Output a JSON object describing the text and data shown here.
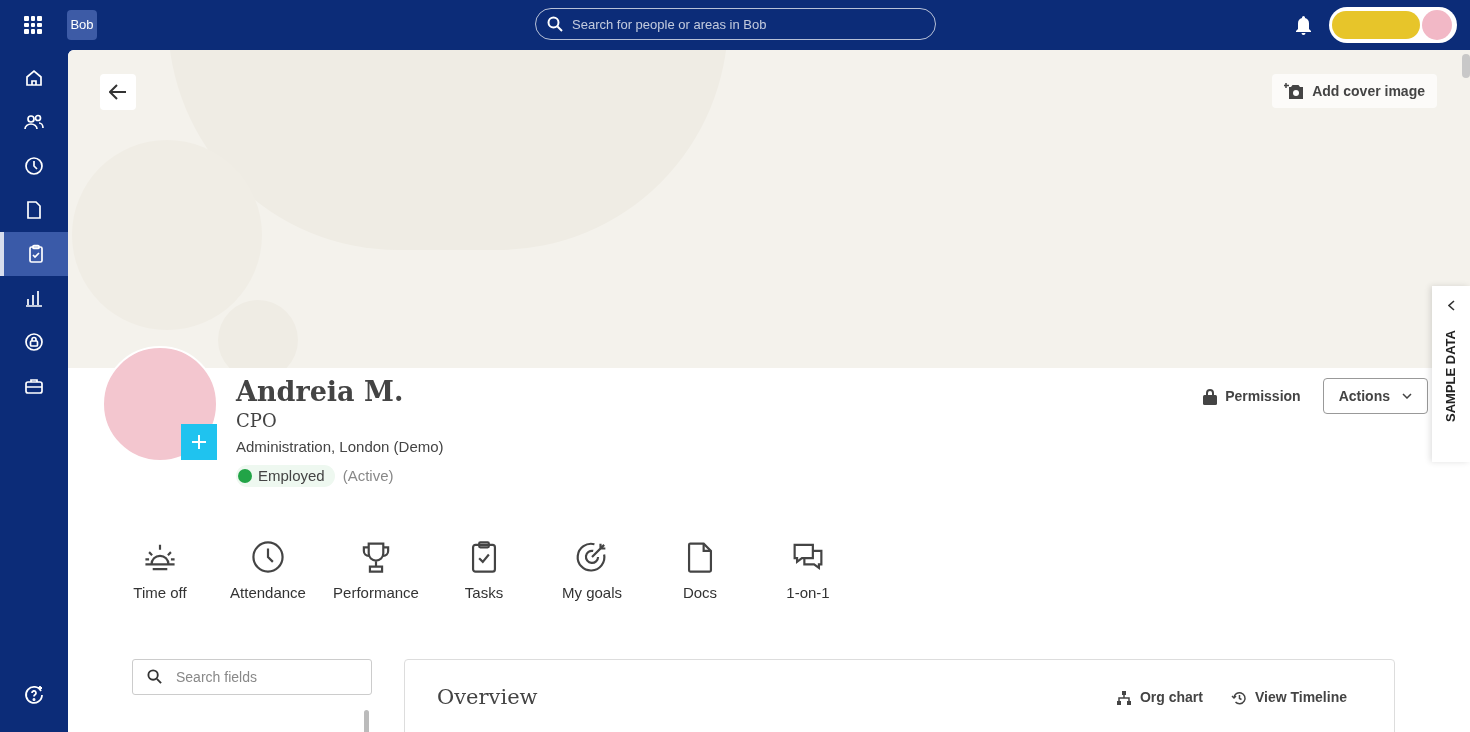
{
  "top_bar": {
    "logo": "Bob",
    "search": {
      "placeholder": "Search for people or areas in Bob"
    }
  },
  "nav_items": [
    {
      "selected": false
    },
    {
      "selected": false
    },
    {
      "selected": false
    },
    {
      "selected": false
    },
    {
      "selected": true
    },
    {
      "selected": false
    },
    {
      "selected": false
    },
    {
      "selected": false
    }
  ],
  "cover": {
    "add_cover_button": "Add cover image"
  },
  "profile": {
    "name": "Andreia M.",
    "title": "CPO",
    "department": "Administration, London (Demo)",
    "status": {
      "label": "Employed",
      "color": "#22a447"
    },
    "state": "(Active)",
    "permission": "Permission",
    "actions": "Actions"
  },
  "side_tab": "SAMPLE DATA",
  "shortcuts": [
    {
      "label": "Time off"
    },
    {
      "label": "Attendance"
    },
    {
      "label": "Performance"
    },
    {
      "label": "Tasks"
    },
    {
      "label": "My goals"
    },
    {
      "label": "Docs"
    },
    {
      "label": "1-on-1"
    }
  ],
  "field_search": {
    "placeholder": "Search fields"
  },
  "overview": {
    "title": "Overview",
    "links": [
      "Org chart",
      "View Timeline"
    ]
  }
}
